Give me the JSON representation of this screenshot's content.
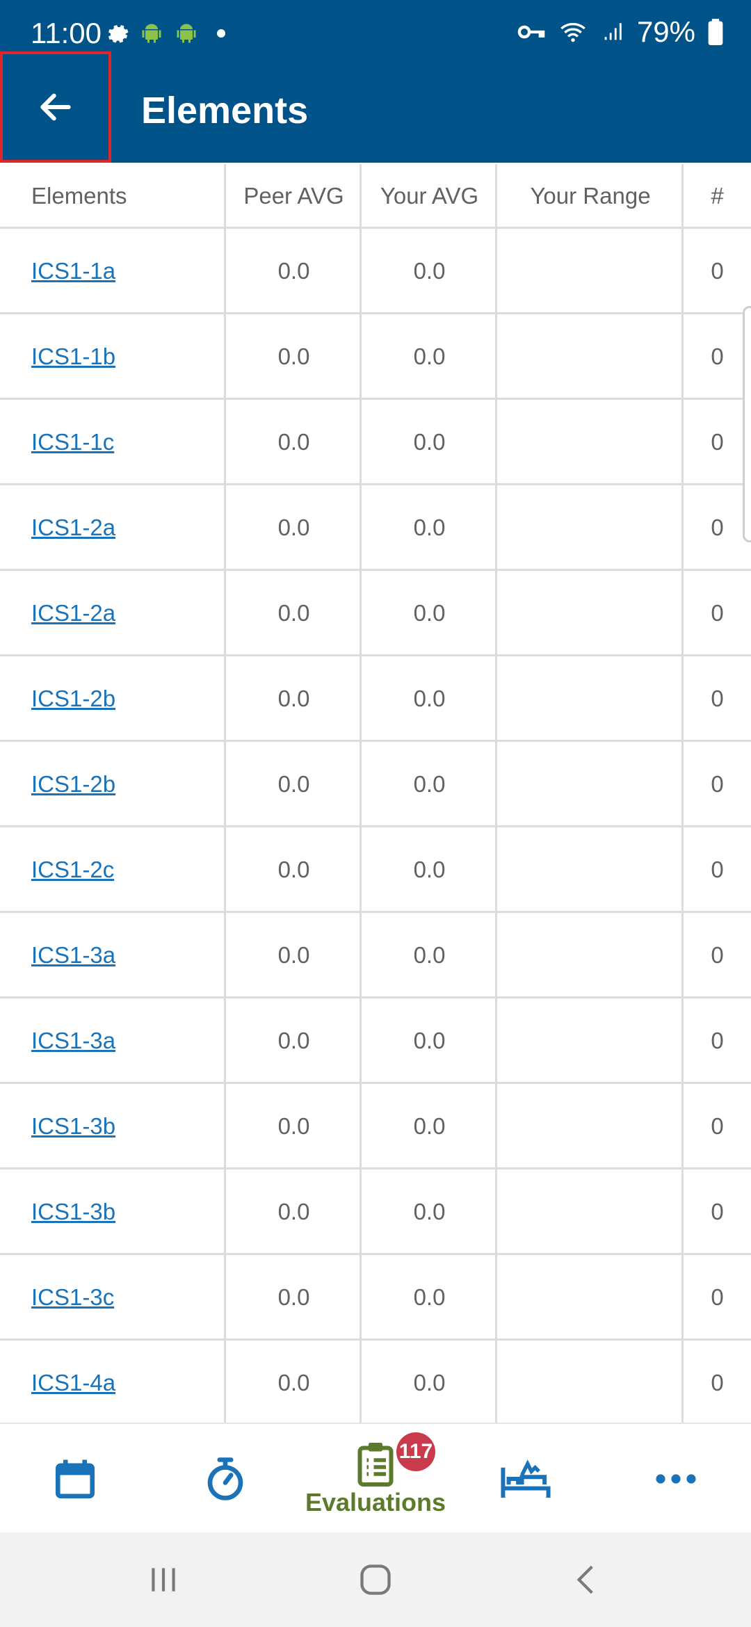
{
  "status_bar": {
    "time": "11:00",
    "battery": "79%",
    "icons": [
      "gear-icon",
      "android-icon",
      "android-icon",
      "dot-icon",
      "vpn-key-icon",
      "wifi-icon",
      "signal-icon",
      "battery-icon"
    ]
  },
  "app_bar": {
    "title": "Elements",
    "back_icon": "arrow-left-icon"
  },
  "table": {
    "headers": [
      "Elements",
      "Peer AVG",
      "Your AVG",
      "Your Range",
      "#"
    ],
    "rows": [
      {
        "element": "ICS1-1a",
        "peer_avg": "0.0",
        "your_avg": "0.0",
        "your_range": "",
        "count": "0"
      },
      {
        "element": "ICS1-1b",
        "peer_avg": "0.0",
        "your_avg": "0.0",
        "your_range": "",
        "count": "0"
      },
      {
        "element": "ICS1-1c",
        "peer_avg": "0.0",
        "your_avg": "0.0",
        "your_range": "",
        "count": "0"
      },
      {
        "element": "ICS1-2a",
        "peer_avg": "0.0",
        "your_avg": "0.0",
        "your_range": "",
        "count": "0"
      },
      {
        "element": "ICS1-2a",
        "peer_avg": "0.0",
        "your_avg": "0.0",
        "your_range": "",
        "count": "0"
      },
      {
        "element": "ICS1-2b",
        "peer_avg": "0.0",
        "your_avg": "0.0",
        "your_range": "",
        "count": "0"
      },
      {
        "element": "ICS1-2b",
        "peer_avg": "0.0",
        "your_avg": "0.0",
        "your_range": "",
        "count": "0"
      },
      {
        "element": "ICS1-2c",
        "peer_avg": "0.0",
        "your_avg": "0.0",
        "your_range": "",
        "count": "0"
      },
      {
        "element": "ICS1-3a",
        "peer_avg": "0.0",
        "your_avg": "0.0",
        "your_range": "",
        "count": "0"
      },
      {
        "element": "ICS1-3a",
        "peer_avg": "0.0",
        "your_avg": "0.0",
        "your_range": "",
        "count": "0"
      },
      {
        "element": "ICS1-3b",
        "peer_avg": "0.0",
        "your_avg": "0.0",
        "your_range": "",
        "count": "0"
      },
      {
        "element": "ICS1-3b",
        "peer_avg": "0.0",
        "your_avg": "0.0",
        "your_range": "",
        "count": "0"
      },
      {
        "element": "ICS1-3c",
        "peer_avg": "0.0",
        "your_avg": "0.0",
        "your_range": "",
        "count": "0"
      },
      {
        "element": "ICS1-4a",
        "peer_avg": "0.0",
        "your_avg": "0.0",
        "your_range": "",
        "count": "0"
      }
    ]
  },
  "bottom_nav": {
    "items": [
      {
        "icon": "calendar-icon",
        "label": ""
      },
      {
        "icon": "stopwatch-icon",
        "label": ""
      },
      {
        "icon": "clipboard-list-icon",
        "label": "Evaluations",
        "badge": "117",
        "active": true
      },
      {
        "icon": "bed-icon",
        "label": ""
      },
      {
        "icon": "more-horizontal-icon",
        "label": ""
      }
    ]
  },
  "system_nav": {
    "icons": [
      "recents-icon",
      "home-icon",
      "back-icon"
    ]
  },
  "colors": {
    "primary": "#005389",
    "link": "#1a73b8",
    "active_nav": "#5b7a2b",
    "badge": "#c93a4c",
    "highlight_border": "#e0262b"
  }
}
